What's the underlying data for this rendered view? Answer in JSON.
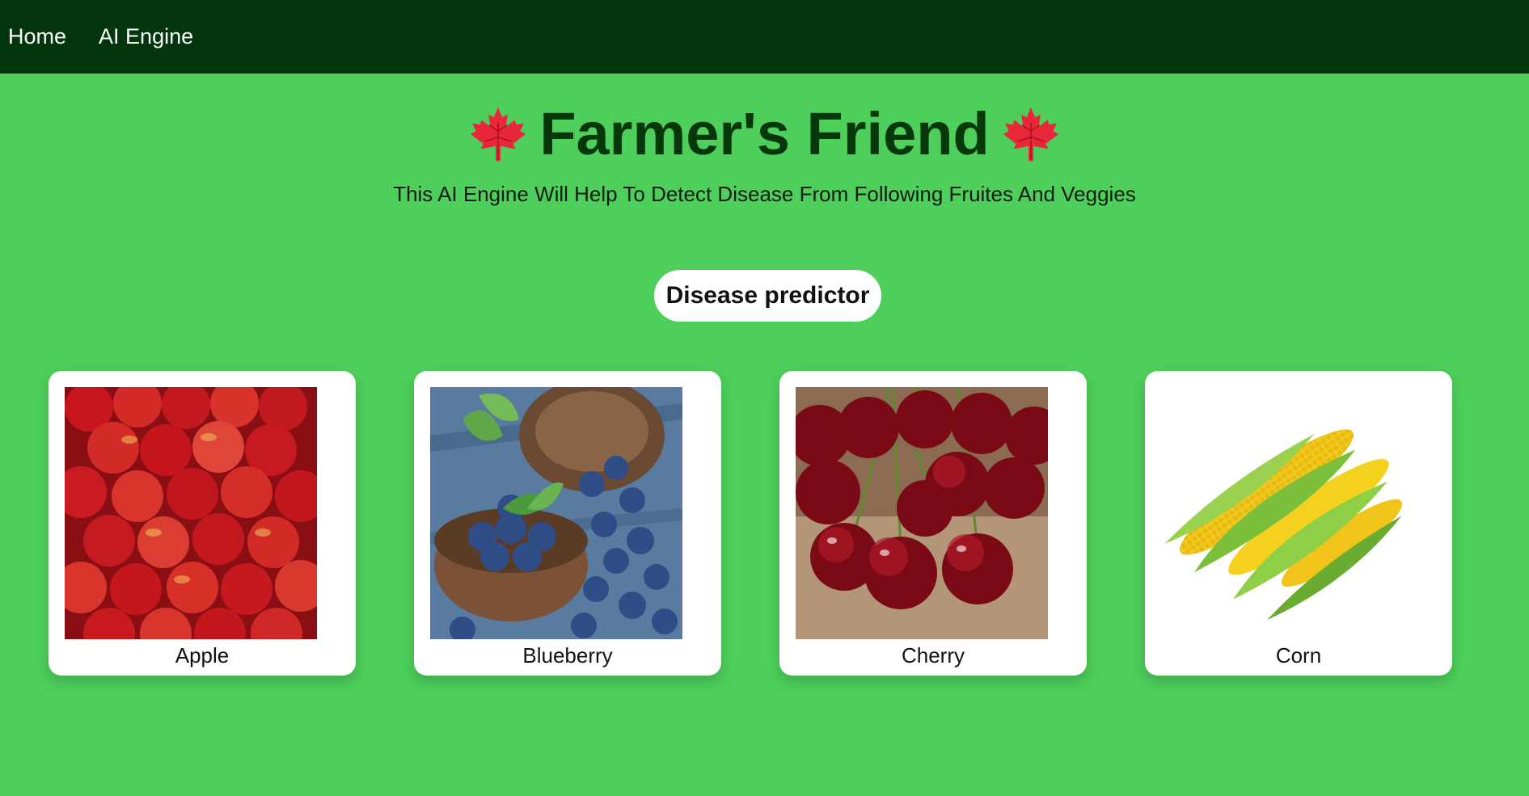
{
  "nav": {
    "items": [
      {
        "label": "Home"
      },
      {
        "label": "AI Engine"
      }
    ]
  },
  "hero": {
    "title": "Farmer's Friend",
    "subtitle": "This AI Engine Will Help To Detect Disease From Following Fruites And Veggies",
    "leaf_icon": "maple-leaf-icon"
  },
  "action": {
    "label": "Disease predictor"
  },
  "cards": [
    {
      "label": "Apple"
    },
    {
      "label": "Blueberry"
    },
    {
      "label": "Cherry"
    },
    {
      "label": "Corn"
    }
  ],
  "colors": {
    "navbar": "#03360c",
    "background": "#4ecf5b",
    "title": "#06380c",
    "leaf": "#e8273a"
  }
}
